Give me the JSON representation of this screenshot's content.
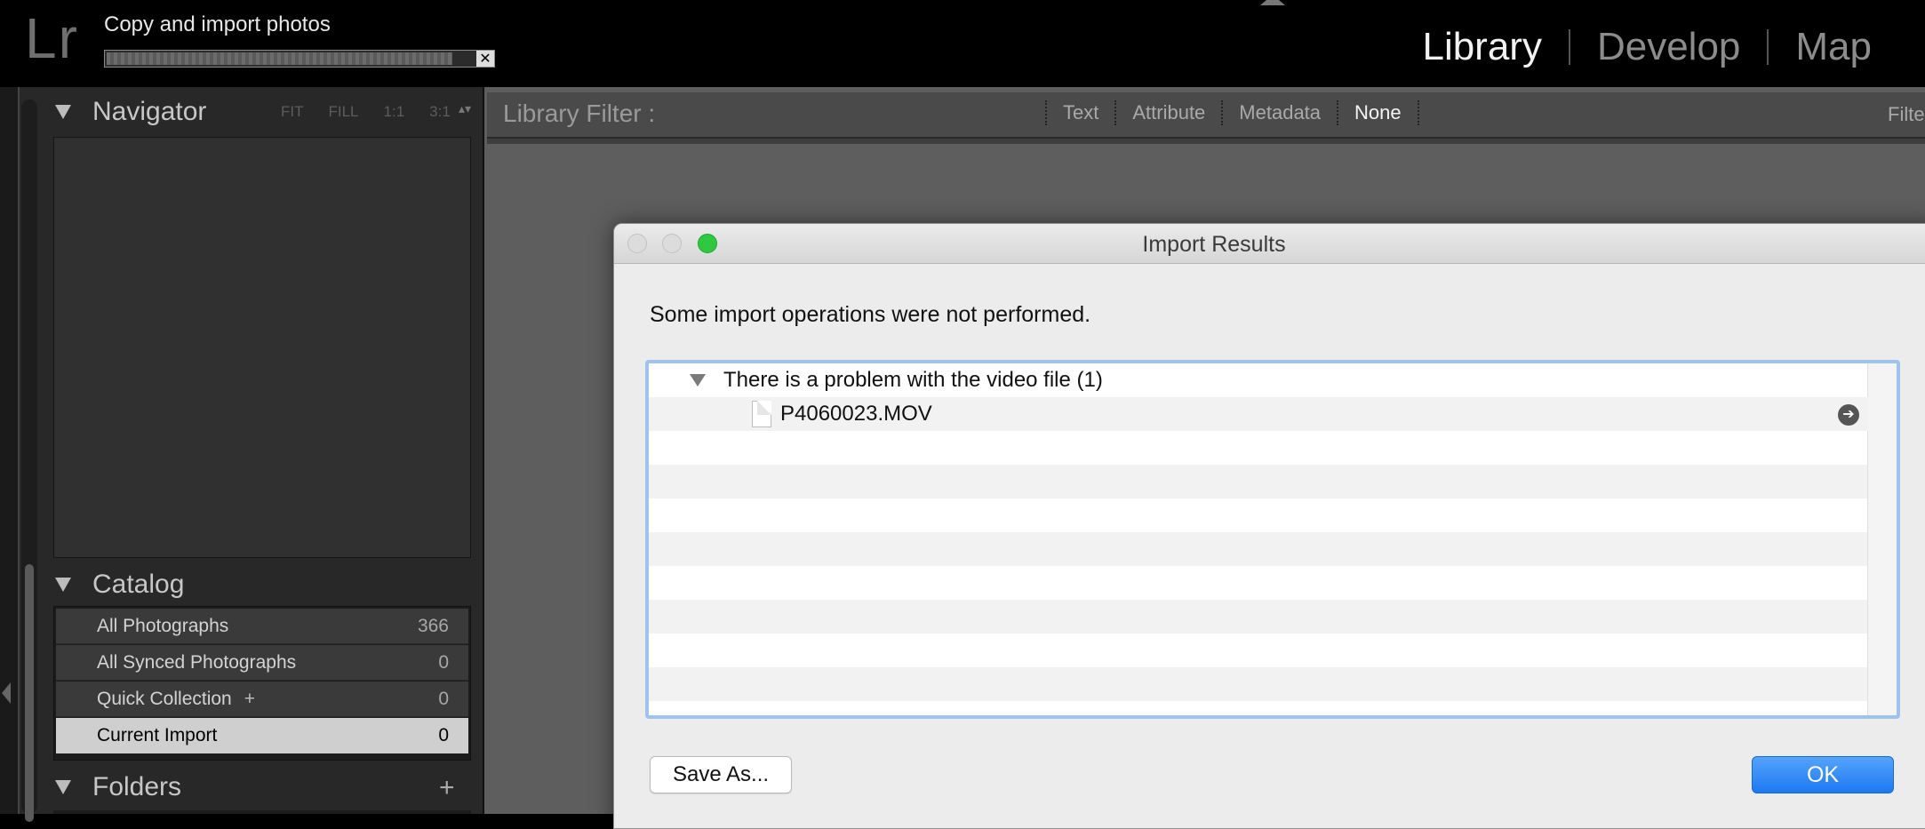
{
  "app": {
    "logo": "Lr",
    "task_title": "Copy and import photos",
    "progress_fraction": 0.94,
    "progress_cancel_glyph": "✕"
  },
  "modules": [
    {
      "label": "Library",
      "active": true
    },
    {
      "label": "Develop",
      "active": false
    },
    {
      "label": "Map",
      "active": false
    }
  ],
  "navigator": {
    "title": "Navigator",
    "zoom_options": [
      "FIT",
      "FILL",
      "1:1",
      "3:1"
    ],
    "zoom_arrow": "▴▾"
  },
  "catalog": {
    "title": "Catalog",
    "items": [
      {
        "label": "All Photographs",
        "count": "366",
        "selected": false
      },
      {
        "label": "All Synced Photographs",
        "count": "0",
        "selected": false
      },
      {
        "label": "Quick Collection",
        "plus": "+",
        "count": "0",
        "selected": false
      },
      {
        "label": "Current Import",
        "count": "0",
        "selected": true
      }
    ]
  },
  "folders": {
    "title": "Folders",
    "add_glyph": "+"
  },
  "library_filter": {
    "label": "Library Filter :",
    "tabs": [
      "Text",
      "Attribute",
      "Metadata",
      "None"
    ],
    "active_tab": "None",
    "right_label": "Filte"
  },
  "dialog": {
    "title": "Import Results",
    "message": "Some import operations were not performed.",
    "group_label": "There is a problem with the video file (1)",
    "file_name": "P4060023.MOV",
    "reveal_glyph": "➔",
    "save_as_label": "Save As...",
    "ok_label": "OK",
    "colors": {
      "ok_button": "#1d79f2",
      "list_focus_ring": "#9fc2ef",
      "zoom_traffic_light": "#2fc840"
    }
  }
}
